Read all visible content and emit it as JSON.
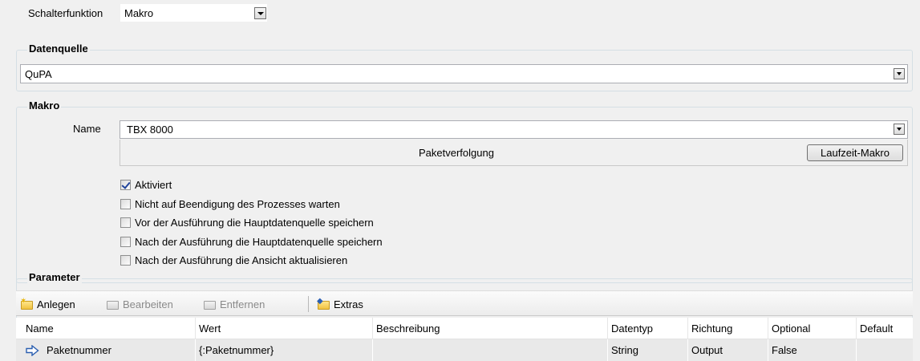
{
  "top": {
    "function_label": "Schalterfunktion",
    "function_value": "Makro"
  },
  "datasource": {
    "title": "Datenquelle",
    "value": "QuPA"
  },
  "macro": {
    "title": "Makro",
    "name_label": "Name",
    "name_value": "TBX 8000",
    "description": "Paketverfolgung",
    "runtime_button": "Laufzeit-Makro",
    "options": [
      {
        "label": "Aktiviert",
        "checked": true
      },
      {
        "label": "Nicht auf Beendigung des Prozesses warten",
        "checked": false
      },
      {
        "label": "Vor der Ausführung die Hauptdatenquelle speichern",
        "checked": false
      },
      {
        "label": "Nach der Ausführung die Hauptdatenquelle speichern",
        "checked": false
      },
      {
        "label": "Nach der Ausführung die Ansicht aktualisieren",
        "checked": false
      }
    ]
  },
  "parameters": {
    "title": "Parameter",
    "toolbar": {
      "add": "Anlegen",
      "edit": "Bearbeiten",
      "remove": "Entfernen",
      "extras": "Extras"
    },
    "columns": [
      "Name",
      "Wert",
      "Beschreibung",
      "Datentyp",
      "Richtung",
      "Optional",
      "Default"
    ],
    "rows": [
      {
        "name": "Paketnummer",
        "value": "{:Paketnummer}",
        "description": "",
        "type": "String",
        "direction": "Output",
        "optional": "False",
        "default": ""
      }
    ]
  }
}
